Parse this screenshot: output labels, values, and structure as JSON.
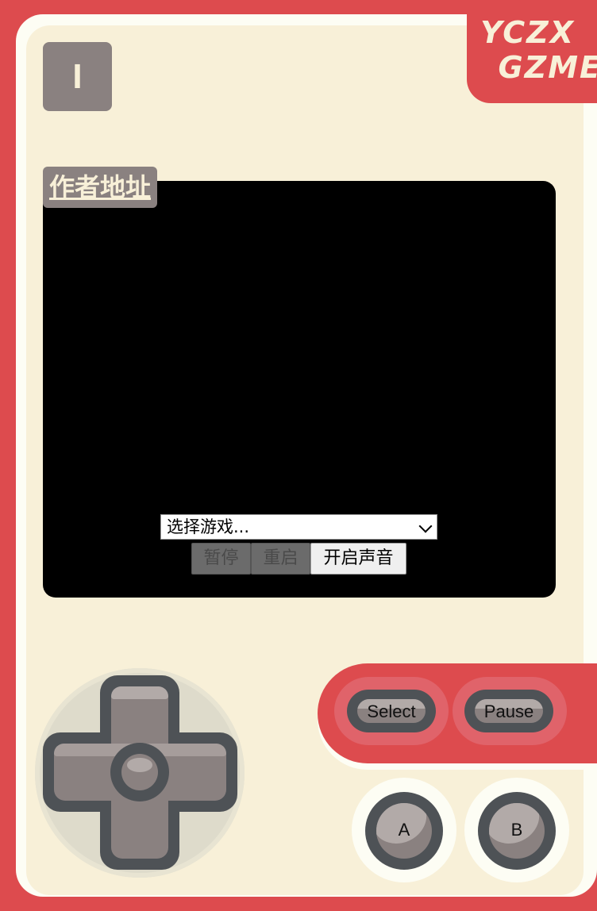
{
  "brand": {
    "line1": "YCZX",
    "line2": "GZME"
  },
  "menu_button": {
    "label": "I"
  },
  "author_link": {
    "label": "作者地址"
  },
  "game_select": {
    "value": "选择游戏..."
  },
  "controls": {
    "pause_label": "暂停",
    "restart_label": "重启",
    "sound_label": "开启声音"
  },
  "system_buttons": {
    "select_label": "Select",
    "pause_label": "Pause"
  },
  "action_buttons": {
    "a_label": "A",
    "b_label": "B"
  },
  "colors": {
    "console_red": "#dd4b4e",
    "face_cream": "#f8f0d8",
    "button_dark": "#4e5256",
    "button_grey": "#8a8180",
    "screen": "#000000"
  }
}
